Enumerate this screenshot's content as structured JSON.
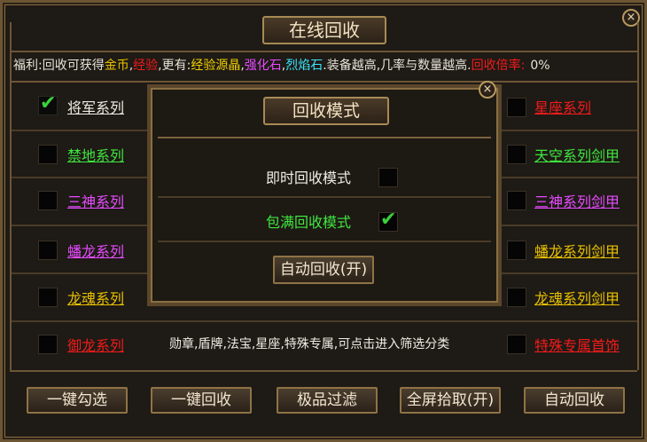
{
  "window": {
    "title": "在线回收",
    "close": "×"
  },
  "info": {
    "prefix": "福利:回收可获得",
    "gold": "金币",
    "comma1": ",",
    "exp": "经验",
    "more": ",更有:",
    "exp_crystal": "经验源晶",
    "comma2": ",",
    "strength_stone": "强化石",
    "comma3": ",",
    "flame_stone": "烈焰石",
    "suffix": ".装备越高,几率与数量越高.",
    "rate_label": "回收倍率:",
    "rate_value": "0%"
  },
  "left_items": [
    {
      "label": "将军系列",
      "checked": true,
      "color": "#f0ede6"
    },
    {
      "label": "禁地系列",
      "checked": false,
      "color": "#3fe63f"
    },
    {
      "label": "三神系列",
      "checked": false,
      "color": "#e64bff"
    },
    {
      "label": "蟠龙系列",
      "checked": false,
      "color": "#e64bff"
    },
    {
      "label": "龙魂系列",
      "checked": false,
      "color": "#e8c100"
    },
    {
      "label": "御龙系列",
      "checked": false,
      "color": "#f21b1b"
    }
  ],
  "right_items": [
    {
      "label": "星座系列",
      "checked": false,
      "color": "#f21b1b"
    },
    {
      "label": "天空系列剑甲",
      "checked": false,
      "color": "#3fe63f"
    },
    {
      "label": "三神系列剑甲",
      "checked": false,
      "color": "#e64bff"
    },
    {
      "label": "蟠龙系列剑甲",
      "checked": false,
      "color": "#e8c100"
    },
    {
      "label": "龙魂系列剑甲",
      "checked": false,
      "color": "#e8c100"
    },
    {
      "label": "特殊专属首饰",
      "checked": false,
      "color": "#f21b1b"
    }
  ],
  "note": "勋章,盾牌,法宝,星座,特殊专属,可点击进入筛选分类",
  "buttons": {
    "select_all": "一键勾选",
    "recycle_all": "一键回收",
    "filter": "极品过滤",
    "pickup": "全屏拾取(开)",
    "auto_recycle": "自动回收"
  },
  "modal": {
    "title": "回收模式",
    "close": "×",
    "instant_label": "即时回收模式",
    "instant_checked": false,
    "full_label": "包满回收模式",
    "full_checked": true,
    "auto_button": "自动回收(开)"
  }
}
